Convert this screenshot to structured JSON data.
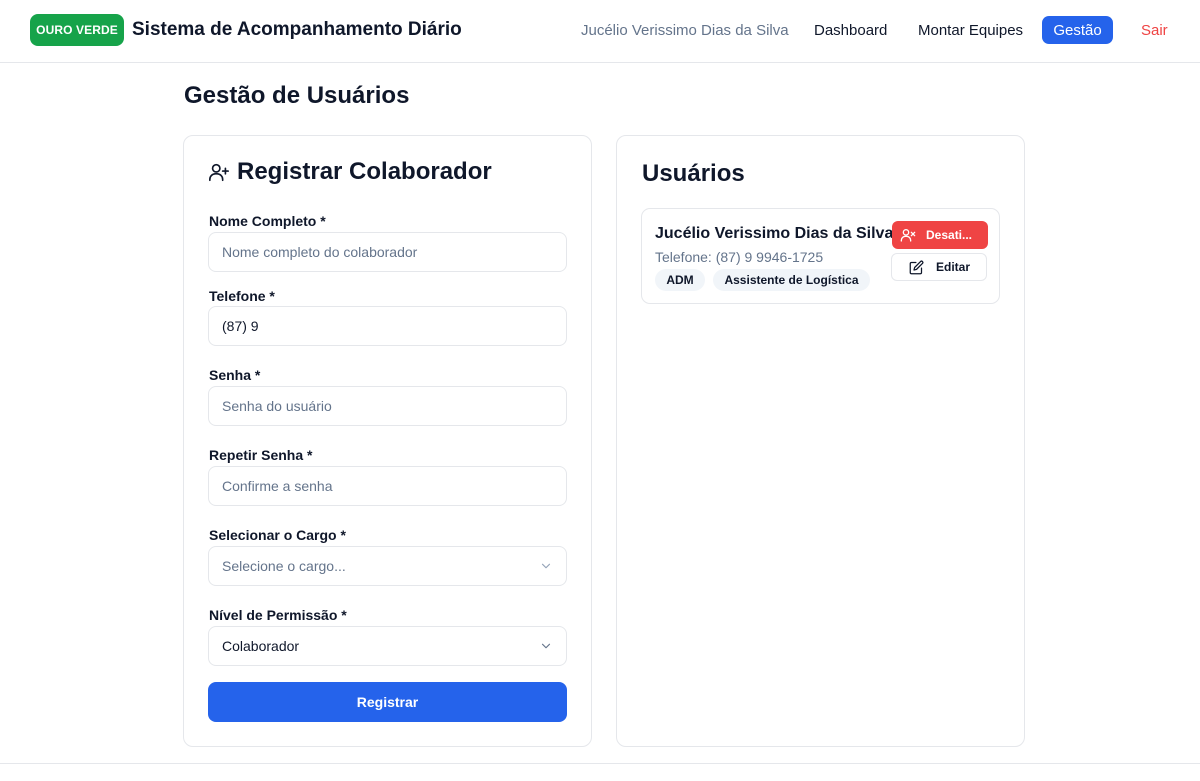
{
  "header": {
    "brand": "OURO VERDE",
    "app_title": "Sistema de Acompanhamento Diário",
    "current_user": "Jucélio Verissimo Dias da Silva",
    "nav": {
      "dashboard": "Dashboard",
      "montar_equipes": "Montar Equipes",
      "gestao": "Gestão",
      "sair": "Sair"
    }
  },
  "page": {
    "title": "Gestão de Usuários"
  },
  "form": {
    "title": "Registrar Colaborador",
    "title_icon": "user-plus-icon",
    "nome": {
      "label": "Nome Completo *",
      "value": "",
      "placeholder": "Nome completo do colaborador"
    },
    "telefone": {
      "label": "Telefone *",
      "value": "(87) 9",
      "placeholder": ""
    },
    "senha": {
      "label": "Senha *",
      "value": "",
      "placeholder": "Senha do usuário"
    },
    "repetir_senha": {
      "label": "Repetir Senha *",
      "value": "",
      "placeholder": "Confirme a senha"
    },
    "cargo": {
      "label": "Selecionar o Cargo *",
      "selected": "Selecione o cargo..."
    },
    "permissao": {
      "label": "Nível de Permissão *",
      "selected": "Colaborador"
    },
    "submit_label": "Registrar"
  },
  "users": {
    "title": "Usuários",
    "items": [
      {
        "name": "Jucélio Verissimo Dias da Silva",
        "phone": "Telefone: (87) 9 9946-1725",
        "badges": [
          "ADM",
          "Assistente de Logística"
        ],
        "deactivate_label": "Desati...",
        "edit_label": "Editar"
      }
    ]
  },
  "colors": {
    "brand_green": "#16a34a",
    "primary_blue": "#2563eb",
    "danger_red": "#ef4444",
    "muted_text": "#64748b",
    "border": "#e5e7eb"
  }
}
